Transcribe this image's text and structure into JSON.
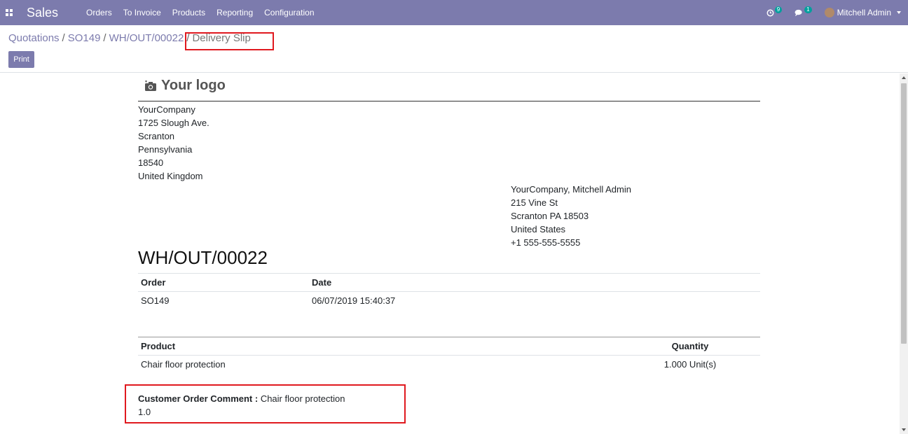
{
  "navbar": {
    "brand": "Sales",
    "menu": [
      "Orders",
      "To Invoice",
      "Products",
      "Reporting",
      "Configuration"
    ],
    "activity_count": "9",
    "message_count": "1",
    "user": "Mitchell Admin"
  },
  "breadcrumb": {
    "items": [
      "Quotations",
      "SO149",
      "WH/OUT/00022"
    ],
    "separator": "/",
    "active": "Delivery Slip"
  },
  "control": {
    "print_label": "Print"
  },
  "report": {
    "logo_text": "Your logo",
    "company_address": [
      "YourCompany",
      "1725 Slough Ave.",
      "Scranton",
      "Pennsylvania",
      "18540",
      "United Kingdom"
    ],
    "partner_address": [
      "YourCompany, Mitchell Admin",
      "215 Vine St",
      "Scranton PA 18503",
      "United States",
      "+1 555-555-5555"
    ],
    "title": "WH/OUT/00022",
    "info_table": {
      "headers": [
        "Order",
        "Date"
      ],
      "values": [
        "SO149",
        "06/07/2019 15:40:37"
      ]
    },
    "lines_table": {
      "headers": [
        "Product",
        "Quantity"
      ],
      "rows": [
        [
          "Chair floor protection",
          "1.000 Unit(s)"
        ]
      ]
    },
    "comment": {
      "label": "Customer Order Comment :",
      "value": " Chair floor protection",
      "extra": "1.0"
    }
  },
  "colors": {
    "navbar": "#7c7bad",
    "highlight": "#e0191f",
    "badge": "#00a09d"
  }
}
